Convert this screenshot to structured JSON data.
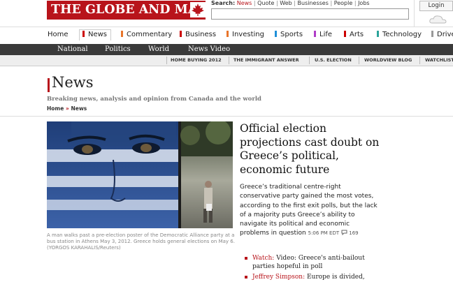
{
  "masthead": {
    "logo_text": "THE GLOBE AND MAIL",
    "search_label": "Search:",
    "search_scopes": [
      "News",
      "Quote",
      "Web",
      "Businesses",
      "People",
      "Jobs"
    ],
    "search_placeholder": "",
    "login_label": "Login",
    "brand_color": "#b8141b"
  },
  "nav": {
    "items": [
      {
        "label": "Home",
        "color": ""
      },
      {
        "label": "News",
        "color": "#cc0000"
      },
      {
        "label": "Commentary",
        "color": "#e8752b"
      },
      {
        "label": "Business",
        "color": "#cc0000"
      },
      {
        "label": "Investing",
        "color": "#e8752b"
      },
      {
        "label": "Sports",
        "color": "#1f8fd8"
      },
      {
        "label": "Life",
        "color": "#b03cc8"
      },
      {
        "label": "Arts",
        "color": "#cc0000"
      },
      {
        "label": "Technology",
        "color": "#2aa39a"
      },
      {
        "label": "Drive",
        "color": "#999999"
      }
    ],
    "active": "News"
  },
  "subnav": {
    "items": [
      "National",
      "Politics",
      "World",
      "News Video"
    ]
  },
  "topics": {
    "items": [
      "HOME BUYING 2012",
      "THE IMMIGRANT ANSWER",
      "U.S. ELECTION",
      "WORLDVIEW BLOG",
      "WATCHLIST"
    ]
  },
  "section": {
    "title": "News",
    "tagline": "Breaking news, analysis and opinion from Canada and the world",
    "breadcrumb": [
      "Home",
      "News"
    ]
  },
  "story": {
    "headline": "Official election projections cast doubt on Greece’s political, economic future",
    "summary": "Greece’s traditional centre-right conservative party gained the most votes, according to the first exit polls, but the lack of a majority puts Greece’s ability to navigate its political and economic problems in question",
    "time": "5:06 PM EDT",
    "comments": "169",
    "caption": "A man walks past a pre-election poster of the Democratic Alliance party at a bus station in Athens May 3, 2012. Greece holds general elections on May 6. (YORGOS KARAHALIS/Reuters)",
    "related": [
      {
        "prefix": "Watch:",
        "text": "Video: Greece's anti-bailout parties hopeful in poll"
      },
      {
        "prefix": "Jeffrey Simpson:",
        "text": "Europe is divided,"
      }
    ]
  }
}
